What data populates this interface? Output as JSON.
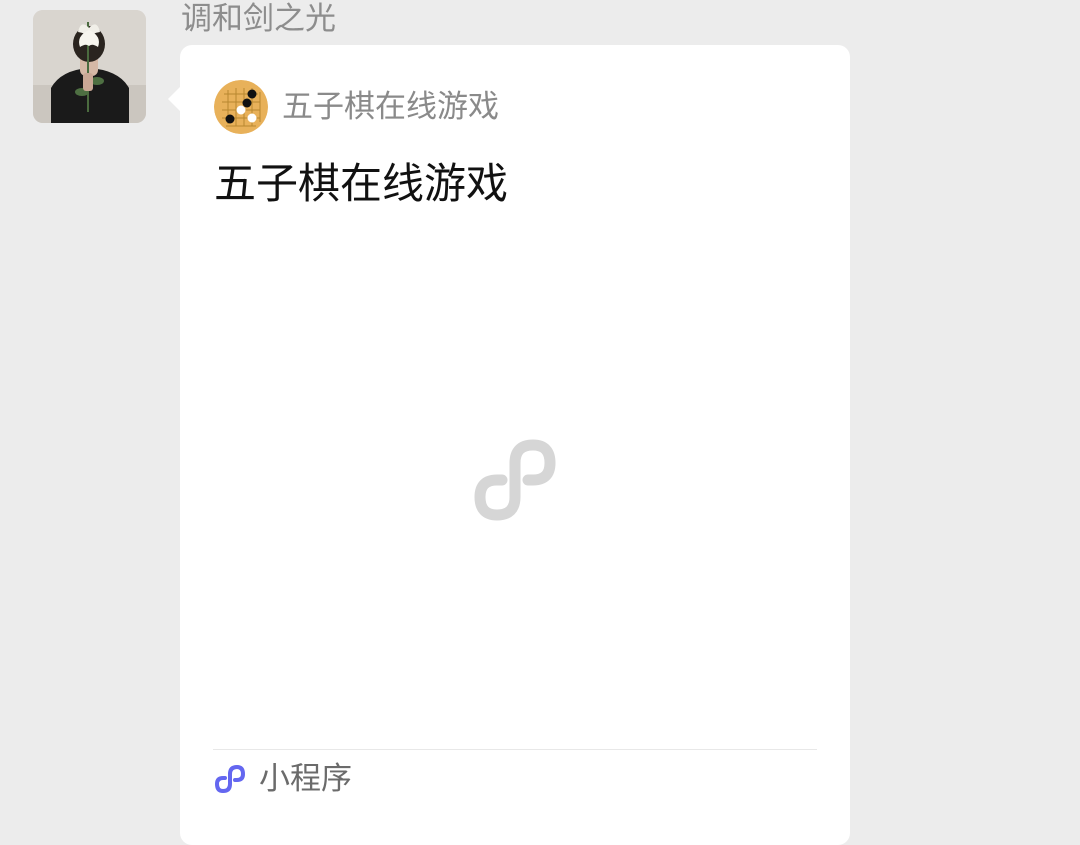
{
  "chat": {
    "sender_name": "调和剑之光"
  },
  "mini_program_card": {
    "app_name": "五子棋在线游戏",
    "title": "五子棋在线游戏",
    "footer_label": "小程序"
  },
  "colors": {
    "background": "#ececec",
    "bubble": "#ffffff",
    "mini_program_accent": "#6467f0",
    "gomoku_board": "#e8b15a"
  }
}
